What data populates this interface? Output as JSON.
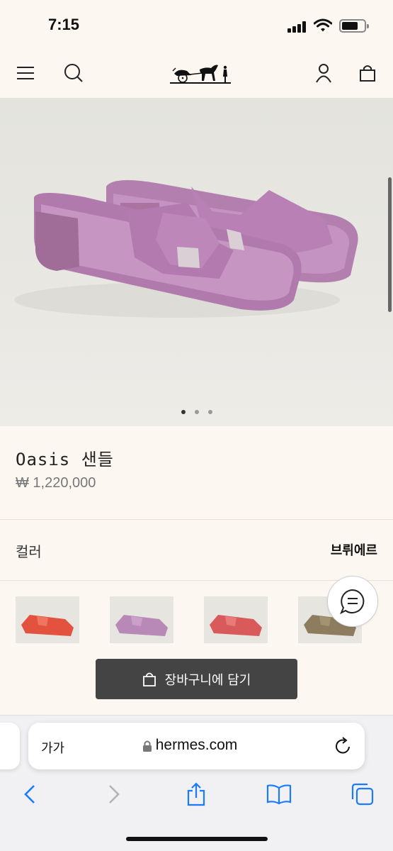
{
  "status_bar": {
    "time": "7:15"
  },
  "header": {
    "menu_icon": "hamburger-menu-icon",
    "search_icon": "search-icon",
    "logo": "hermes-carriage-logo",
    "account_icon": "user-icon",
    "bag_icon": "shopping-bag-icon"
  },
  "gallery": {
    "image_count": 3,
    "active_index": 0
  },
  "product": {
    "name": "Oasis 샌들",
    "price": "₩ 1,220,000"
  },
  "color": {
    "label": "컬러",
    "selected": "브뤼에르",
    "swatches": [
      {
        "name": "red-orange",
        "color": "#e2523f"
      },
      {
        "name": "mauve",
        "color": "#b888b7"
      },
      {
        "name": "coral-red",
        "color": "#d85a5a"
      },
      {
        "name": "taupe",
        "color": "#8e7c5e"
      }
    ]
  },
  "chat_icon": "chat-bubble-icon",
  "cart_button": {
    "label": "장바구니에 담기",
    "icon": "shopping-bag-icon"
  },
  "browser": {
    "text_size_label": "가가",
    "url": "hermes.com",
    "lock_icon": "lock-icon",
    "reload_icon": "reload-icon",
    "toolbar": [
      "back-icon",
      "forward-icon",
      "share-icon",
      "bookmarks-icon",
      "tabs-icon"
    ]
  },
  "colors": {
    "background": "#fcf7f1",
    "cart_button": "#444444",
    "product_mauve": "#b884b4"
  }
}
